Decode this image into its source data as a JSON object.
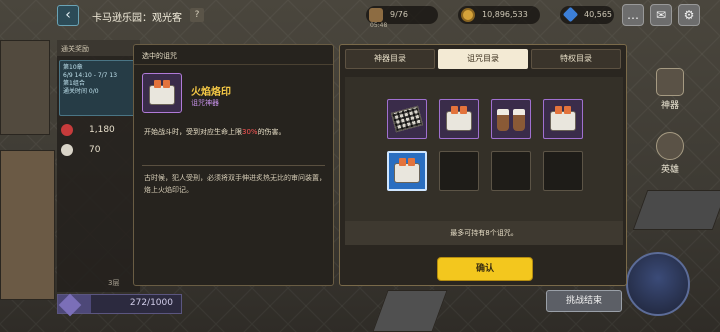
{
  "topbar": {
    "back_icon": "arrow-left-icon",
    "stage_title": "卡马逊乐园：观光客",
    "help_label": "?",
    "food": "9/76",
    "food_sub": "05:48",
    "coins": "10,896,533",
    "gems": "40,565"
  },
  "left_panel": {
    "header": "通关奖励",
    "card_line1": "第10章",
    "card_line2": "6/9 14:10 - 7/7 13",
    "card_line3": "第1组合",
    "card_line4": "通关时间 0/0",
    "stat1": "1,180",
    "stat2": "70",
    "floor": "3层",
    "progress_text": "272/1000",
    "progress_value": 0.272
  },
  "side": {
    "artifact_label": "神器",
    "hero_label": "英雄",
    "end_label": "挑战结束"
  },
  "detail": {
    "header": "选中的诅咒",
    "name": "火焰烙印",
    "type": "诅咒神器",
    "effect_prefix": "开始战斗时，受到对应生命上限",
    "effect_highlight": "30%",
    "effect_suffix": "的伤害。",
    "flavor": "古时候，犯人受刑，必须将双手伸进炙热无比的审问装置，烙上火焰印记。"
  },
  "catalog": {
    "tabs": [
      {
        "label": "神器目录"
      },
      {
        "label": "诅咒目录"
      },
      {
        "label": "特权目录"
      }
    ],
    "active_tab": "诅咒目录",
    "slots": [
      {
        "item": "keyboard-icon"
      },
      {
        "item": "toaster-icon"
      },
      {
        "item": "boots-icon"
      },
      {
        "item": "toaster-icon"
      },
      {
        "item": "toaster-icon",
        "selected": true
      },
      {
        "item": ""
      },
      {
        "item": ""
      },
      {
        "item": ""
      }
    ],
    "capacity_text": "最多可持有8个诅咒。",
    "confirm_label": "确认"
  },
  "colors": {
    "accent_gold": "#f3c71e",
    "curse_name": "#f5c946",
    "curse_type": "#c792ea",
    "damage_highlight": "#ff5757",
    "selected_slot": "#2a6ec0"
  }
}
